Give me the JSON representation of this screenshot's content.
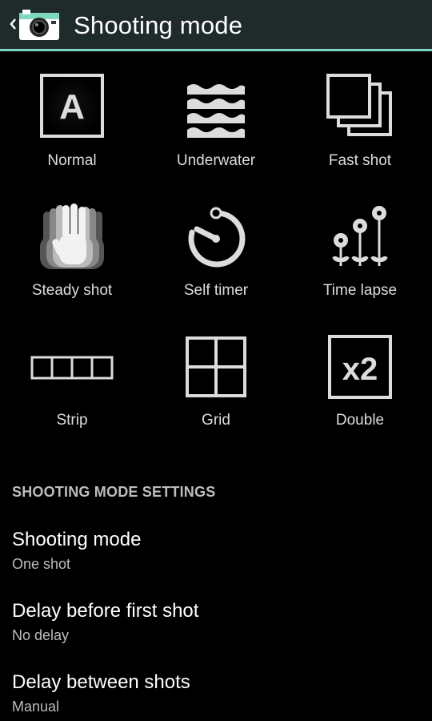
{
  "actionbar": {
    "title": "Shooting mode",
    "up_icon": "chevron-left-icon",
    "app_icon": "camera-icon",
    "accent_color": "#7fd9c0"
  },
  "modes": [
    {
      "label": "Normal",
      "icon": "auto-a-icon"
    },
    {
      "label": "Underwater",
      "icon": "waves-icon"
    },
    {
      "label": "Fast shot",
      "icon": "stacked-frames-icon"
    },
    {
      "label": "Steady shot",
      "icon": "hand-icon"
    },
    {
      "label": "Self timer",
      "icon": "timer-icon"
    },
    {
      "label": "Time lapse",
      "icon": "flowers-icon"
    },
    {
      "label": "Strip",
      "icon": "strip-icon"
    },
    {
      "label": "Grid",
      "icon": "grid-icon"
    },
    {
      "label": "Double",
      "icon": "x2-icon"
    }
  ],
  "x2_text": "x2",
  "auto_letter": "A",
  "settings": {
    "header": "SHOOTING MODE SETTINGS",
    "items": [
      {
        "title": "Shooting mode",
        "summary": "One shot"
      },
      {
        "title": "Delay before first shot",
        "summary": "No delay"
      },
      {
        "title": "Delay between shots",
        "summary": "Manual"
      }
    ]
  }
}
